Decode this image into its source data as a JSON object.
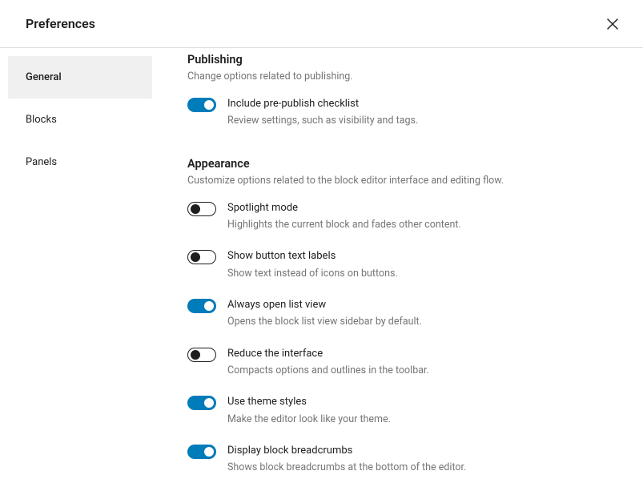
{
  "header": {
    "title": "Preferences"
  },
  "sidebar": {
    "tabs": [
      {
        "label": "General",
        "active": true
      },
      {
        "label": "Blocks",
        "active": false
      },
      {
        "label": "Panels",
        "active": false
      }
    ]
  },
  "sections": [
    {
      "title": "Publishing",
      "desc": "Change options related to publishing.",
      "options": [
        {
          "on": true,
          "label": "Include pre-publish checklist",
          "desc": "Review settings, such as visibility and tags."
        }
      ]
    },
    {
      "title": "Appearance",
      "desc": "Customize options related to the block editor interface and editing flow.",
      "options": [
        {
          "on": false,
          "label": "Spotlight mode",
          "desc": "Highlights the current block and fades other content."
        },
        {
          "on": false,
          "label": "Show button text labels",
          "desc": "Show text instead of icons on buttons."
        },
        {
          "on": true,
          "label": "Always open list view",
          "desc": "Opens the block list view sidebar by default."
        },
        {
          "on": false,
          "label": "Reduce the interface",
          "desc": "Compacts options and outlines in the toolbar."
        },
        {
          "on": true,
          "label": "Use theme styles",
          "desc": "Make the editor look like your theme."
        },
        {
          "on": true,
          "label": "Display block breadcrumbs",
          "desc": "Shows block breadcrumbs at the bottom of the editor."
        }
      ]
    }
  ]
}
